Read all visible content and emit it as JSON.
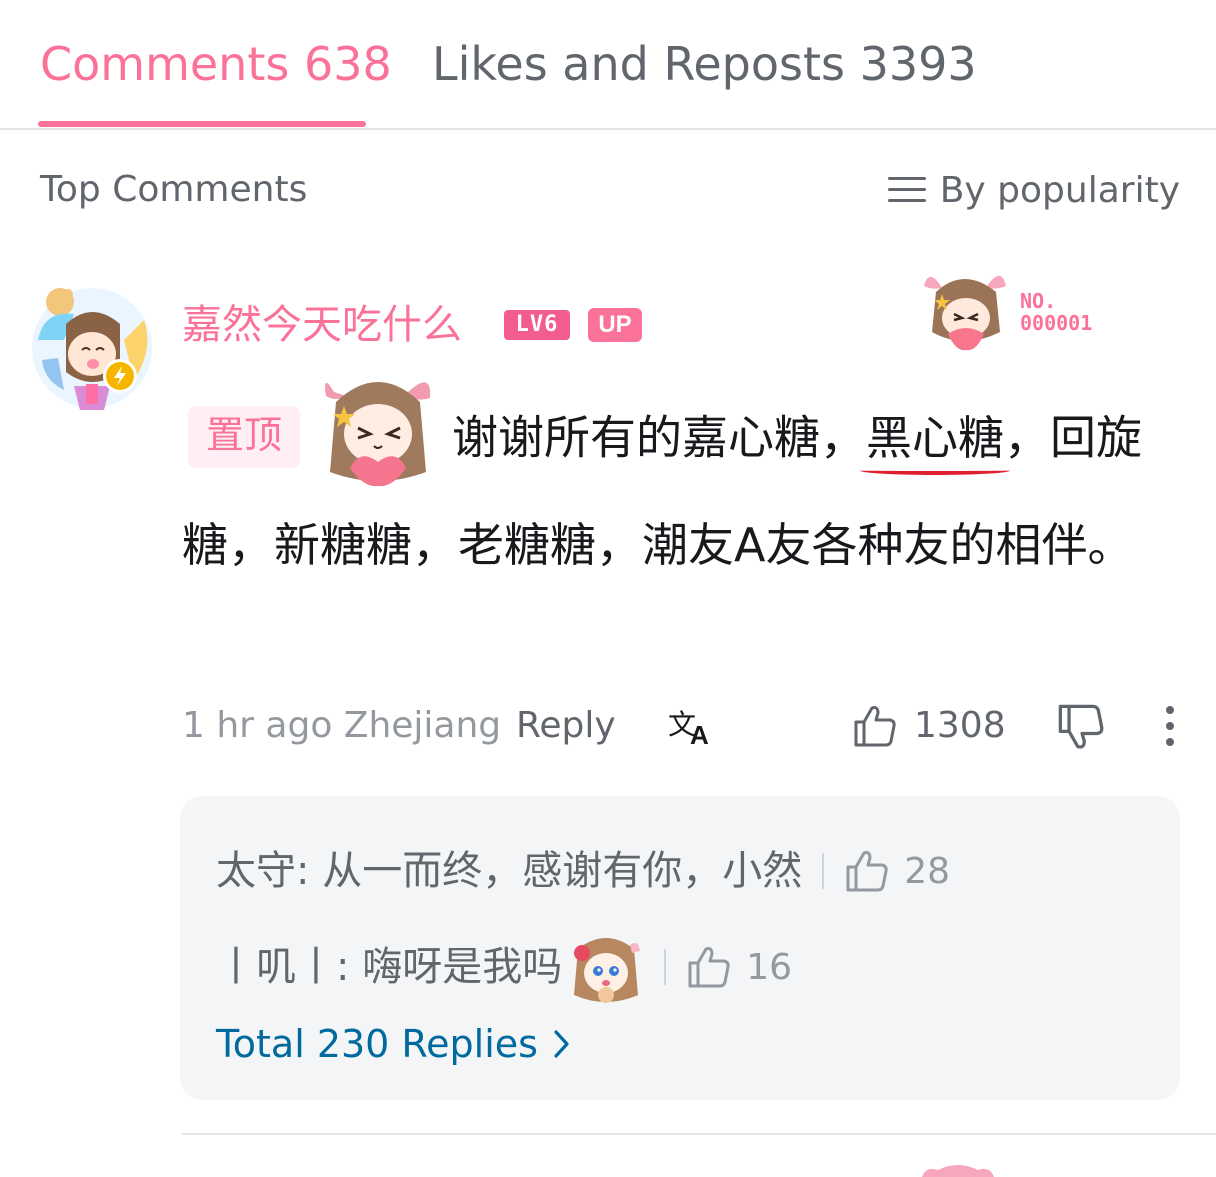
{
  "tabs": [
    {
      "label": "Comments 638",
      "active": true
    },
    {
      "label": "Likes and Reposts 3393",
      "active": false
    }
  ],
  "section": {
    "title": "Top Comments",
    "sort_label": "By popularity"
  },
  "comment": {
    "username": "嘉然今天吃什么",
    "level_badge": "LV6",
    "up_badge": "UP",
    "fan_card_no_label": "NO.",
    "fan_card_number": "000001",
    "pin_tag": "置顶",
    "text_before": "谢谢所有的嘉心糖，",
    "text_underlined": "黑心糖",
    "text_after": "，回旋糖，新糖糖，老糖糖，潮友A友各种友的相伴。",
    "time_location": "1 hr ago Zhejiang",
    "reply_label": "Reply",
    "like_count": "1308"
  },
  "replies": [
    {
      "text": "太守: 从一而终，感谢有你，小然",
      "like_count": "28",
      "has_emote": false
    },
    {
      "text": "丨叽丨: 嗨呀是我吗",
      "like_count": "16",
      "has_emote": true
    }
  ],
  "total_replies_label": "Total 230 Replies",
  "colors": {
    "accent_pink": "#fb7299",
    "link_blue": "#00699d",
    "underline_red": "#e0202f",
    "text_gray": "#61666d"
  },
  "icons": [
    "sort-lines-icon",
    "translate-icon",
    "thumbs-up-icon",
    "thumbs-down-icon",
    "more-vertical-icon",
    "chevron-right-icon"
  ]
}
